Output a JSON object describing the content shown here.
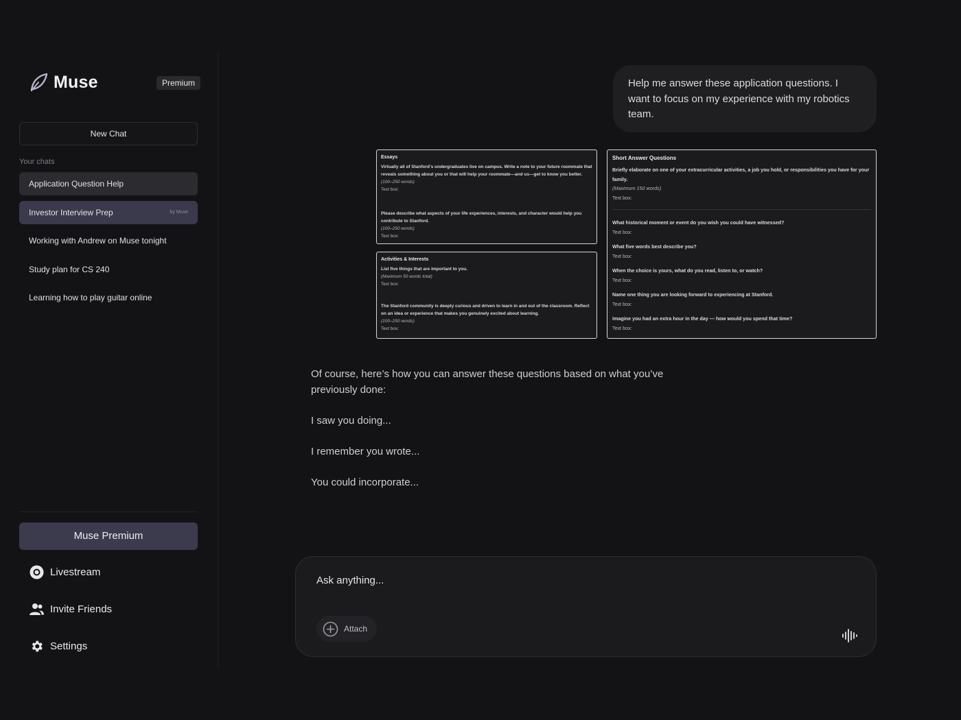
{
  "app": {
    "name": "Muse",
    "badge": "Premium"
  },
  "sidebar": {
    "new_chat": "New Chat",
    "section_label": "Your chats",
    "chats": [
      {
        "label": "Application Question Help",
        "tag": ""
      },
      {
        "label": "Investor Interview Prep",
        "tag": "by Muse"
      },
      {
        "label": "Working with Andrew on Muse tonight",
        "tag": ""
      },
      {
        "label": "Study plan for CS 240",
        "tag": ""
      },
      {
        "label": "Learning how to play guitar online",
        "tag": ""
      }
    ],
    "premium_button": "Muse Premium",
    "menu": [
      {
        "label": "Livestream",
        "icon": "livestream-icon"
      },
      {
        "label": "Invite Friends",
        "icon": "users-icon"
      },
      {
        "label": "Settings",
        "icon": "gear-icon"
      }
    ]
  },
  "conversation": {
    "user_message": "Help me answer these application questions. I want to focus on my experience with my robotics team.",
    "attachments": {
      "essays": {
        "title": "Essays",
        "q1": "Virtually all of Stanford's undergraduates live on campus. Write a note to your future roommate that reveals something about you or that will help your roommate—and us—get to know you better.",
        "q1_limit": "(100–250 words)",
        "q2": "Please describe what aspects of your life experiences, interests, and character would help you contribute to Stanford.",
        "q2_limit": "(100–250 words)",
        "textbox": "Text box:"
      },
      "activities": {
        "title": "Activities & Interests",
        "q1": "List five things that are important to you.",
        "q1_limit": "(Maximum 50 words total)",
        "q2": "The Stanford community is deeply curious and driven to learn in and out of the classroom. Reflect on an idea or experience that makes you genuinely excited about learning.",
        "q2_limit": "(100–250 words)",
        "textbox": "Text box:"
      },
      "short_answers": {
        "title": "Short Answer Questions",
        "q1": "Briefly elaborate on one of your extracurricular activities, a job you hold, or responsibilities you have for your family.",
        "q1_limit": "(Maximum 150 words)",
        "questions": [
          "What historical moment or event do you wish you could have witnessed?",
          "What five words best describe you?",
          "When the choice is yours, what do you read, listen to, or watch?",
          "Name one thing you are looking forward to experiencing at Stanford.",
          "Imagine you had an extra hour in the day — how would you spend that time?"
        ],
        "textbox": "Text box:"
      }
    },
    "assistant_reply": [
      "Of course, here’s how you can answer these questions based on what you’ve previously done:",
      "I saw you doing...",
      "I remember you wrote...",
      "You could incorporate..."
    ]
  },
  "composer": {
    "placeholder": "Ask anything...",
    "attach_label": "Attach",
    "voice_icon": "voice-waveform-icon"
  }
}
